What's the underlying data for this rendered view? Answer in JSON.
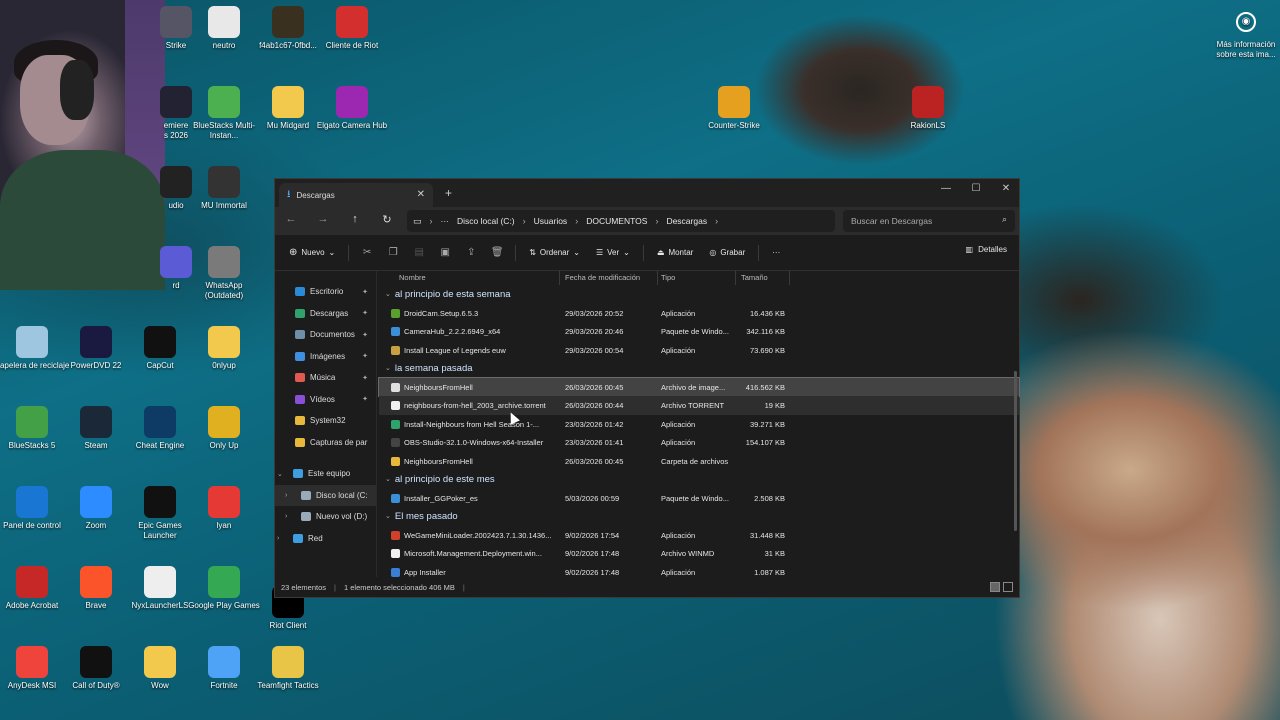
{
  "desktop_icons": [
    {
      "label": "Strike",
      "color": "#556"
    },
    {
      "label": "neutro",
      "color": "#e8e8e8"
    },
    {
      "label": "f4ab1c67-0fbd...",
      "color": "#3a3020"
    },
    {
      "label": "Cliente de Riot",
      "color": "#d32f2f"
    },
    {
      "label": "emiere\ns 2026",
      "color": "#223"
    },
    {
      "label": "BlueStacks Multi-Instan...",
      "color": "#4caf50"
    },
    {
      "label": "Mu Midgard",
      "color": "#f2c94c"
    },
    {
      "label": "Elgato Camera Hub",
      "color": "#9c27b0"
    },
    {
      "label": "udio",
      "color": "#222"
    },
    {
      "label": "MU Immortal",
      "color": "#333"
    },
    {
      "label": "rd",
      "color": "#5b5bd6"
    },
    {
      "label": "WhatsApp (Outdated)",
      "color": "#7a7a7a"
    },
    {
      "label": "Papelera de reciclaje",
      "color": "#9fc6e0"
    },
    {
      "label": "PowerDVD 22",
      "color": "#1a1a40"
    },
    {
      "label": "CapCut",
      "color": "#111"
    },
    {
      "label": "0nlyup",
      "color": "#f2c94c"
    },
    {
      "label": "BlueStacks 5",
      "color": "#43a047"
    },
    {
      "label": "Steam",
      "color": "#1b2838"
    },
    {
      "label": "Cheat Engine",
      "color": "#0d3b66"
    },
    {
      "label": "Only Up",
      "color": "#e0b020"
    },
    {
      "label": "Panel de control",
      "color": "#1976d2"
    },
    {
      "label": "Zoom",
      "color": "#2d8cff"
    },
    {
      "label": "Epic Games Launcher",
      "color": "#111"
    },
    {
      "label": "lyan",
      "color": "#e53935"
    },
    {
      "label": "Adobe Acrobat",
      "color": "#c62828"
    },
    {
      "label": "Brave",
      "color": "#fb542b"
    },
    {
      "label": "NyxLauncherLS",
      "color": "#eeeeee"
    },
    {
      "label": "Google Play Games",
      "color": "#34a853"
    },
    {
      "label": "AnyDesk MSI",
      "color": "#ef443b"
    },
    {
      "label": "Call of Duty®",
      "color": "#111"
    },
    {
      "label": "Wow",
      "color": "#f2c94c"
    },
    {
      "label": "Fortnite",
      "color": "#4fa3f7"
    },
    {
      "label": "Teamfight Tactics",
      "color": "#e8c547"
    },
    {
      "label": "Riot Client",
      "color": "#000"
    },
    {
      "label": "Counter-Strike",
      "color": "#e6a020"
    },
    {
      "label": "RakionLS",
      "color": "#b22"
    }
  ],
  "info_widget": {
    "label": "Más información sobre esta ima..."
  },
  "window": {
    "tab_title": "Descargas",
    "tab_close": "✕",
    "new_tab": "+",
    "controls": {
      "minimize": "—",
      "maximize": "☐",
      "close": "✕"
    }
  },
  "address": {
    "segments": [
      "Disco local (C:)",
      "Usuarios",
      "DOCUMENTOS",
      "Descargas"
    ],
    "more": "···"
  },
  "search": {
    "placeholder": "Buscar en Descargas"
  },
  "toolbar": {
    "new_label": "Nuevo",
    "sort_label": "Ordenar",
    "view_label": "Ver",
    "mount_label": "Montar",
    "burn_label": "Grabar",
    "more": "···",
    "details_label": "Detalles"
  },
  "sidebar": [
    {
      "label": "Escritorio",
      "pinned": true,
      "color": "#2b8ad6"
    },
    {
      "label": "Descargas",
      "pinned": true,
      "color": "#2fa36b"
    },
    {
      "label": "Documentos",
      "pinned": true,
      "color": "#6f8fa8"
    },
    {
      "label": "Imágenes",
      "pinned": true,
      "color": "#3f8ee0"
    },
    {
      "label": "Música",
      "pinned": true,
      "color": "#e05a4f"
    },
    {
      "label": "Vídeos",
      "pinned": true,
      "color": "#8a4fd6"
    },
    {
      "label": "System32",
      "pinned": false,
      "color": "#e8b83a"
    },
    {
      "label": "Capturas de par",
      "pinned": false,
      "color": "#e8b83a"
    }
  ],
  "sidebar_tree": [
    {
      "label": "Este equipo",
      "chev": "⌄",
      "color": "#3f9ee0"
    },
    {
      "label": "Disco local (C:",
      "chev": "›",
      "color": "#9ab"
    },
    {
      "label": "Nuevo vol (D:)",
      "chev": "›",
      "color": "#9ab"
    },
    {
      "label": "Red",
      "chev": "›",
      "color": "#3f9ee0"
    }
  ],
  "columns": {
    "name": "Nombre",
    "date": "Fecha de modificación",
    "type": "Tipo",
    "size": "Tamaño"
  },
  "groups": [
    {
      "title": "al principio de esta semana",
      "rows": [
        {
          "name": "DroidCam.Setup.6.5.3",
          "date": "29/03/2026 20:52",
          "type": "Aplicación",
          "size": "16.436 KB",
          "icon": "#5aa02c"
        },
        {
          "name": "CameraHub_2.2.2.6949_x64",
          "date": "29/03/2026 20:46",
          "type": "Paquete de Windo...",
          "size": "342.116 KB",
          "icon": "#3a8fd6"
        },
        {
          "name": "Install League of Legends euw",
          "date": "29/03/2026 00:54",
          "type": "Aplicación",
          "size": "73.690 KB",
          "icon": "#c8a040"
        }
      ]
    },
    {
      "title": "la semana pasada",
      "rows": [
        {
          "name": "NeighboursFromHell",
          "date": "26/03/2026 00:45",
          "type": "Archivo de image...",
          "size": "416.562 KB",
          "icon": "#e0e0e0"
        },
        {
          "name": "neighbours-from-hell_2003_archive.torrent",
          "date": "26/03/2026 00:44",
          "type": "Archivo TORRENT",
          "size": "19 KB",
          "icon": "#f0f0f0"
        },
        {
          "name": "Install-Neighbours from Hell Season 1-...",
          "date": "23/03/2026 01:42",
          "type": "Aplicación",
          "size": "39.271 KB",
          "icon": "#2fa36b"
        },
        {
          "name": "OBS-Studio-32.1.0-Windows-x64-Installer",
          "date": "23/03/2026 01:41",
          "type": "Aplicación",
          "size": "154.107 KB",
          "icon": "#444"
        },
        {
          "name": "NeighboursFromHell",
          "date": "26/03/2026 00:45",
          "type": "Carpeta de archivos",
          "size": "",
          "icon": "#e8b83a"
        }
      ]
    },
    {
      "title": "al principio de este mes",
      "rows": [
        {
          "name": "Installer_GGPoker_es",
          "date": "5/03/2026 00:59",
          "type": "Paquete de Windo...",
          "size": "2.508 KB",
          "icon": "#3a8fd6"
        }
      ]
    },
    {
      "title": "El mes pasado",
      "rows": [
        {
          "name": "WeGameMiniLoader.2002423.7.1.30.1436...",
          "date": "9/02/2026 17:54",
          "type": "Aplicación",
          "size": "31.448 KB",
          "icon": "#d0402a"
        },
        {
          "name": "Microsoft.Management.Deployment.win...",
          "date": "9/02/2026 17:48",
          "type": "Archivo WINMD",
          "size": "31 KB",
          "icon": "#f0f0f0"
        },
        {
          "name": "App Installer",
          "date": "9/02/2026 17:48",
          "type": "Aplicación",
          "size": "1.087 KB",
          "icon": "#3a7fd6"
        }
      ]
    }
  ],
  "status": {
    "count": "23 elementos",
    "selection": "1 elemento seleccionado  406 MB"
  }
}
